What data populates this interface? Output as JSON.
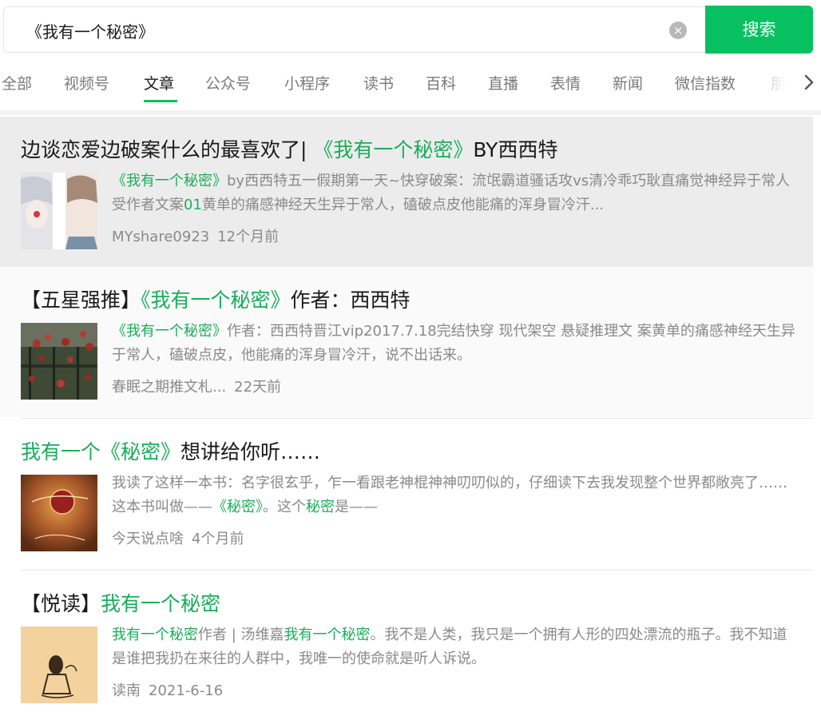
{
  "search": {
    "value": "《我有一个秘密》",
    "clear_label": "×",
    "button_label": "搜索"
  },
  "tabs": [
    "全部",
    "视频号",
    "文章",
    "公众号",
    "小程序",
    "读书",
    "百科",
    "直播",
    "表情",
    "新闻",
    "微信指数",
    "朋友"
  ],
  "active_tab": "文章",
  "results": [
    {
      "title_pre": "边谈恋爱边破案什么的最喜欢了| ",
      "title_hl": "《我有一个秘密》",
      "title_post": "BY西西特",
      "desc_hl": "《我有一个秘密》",
      "desc_rest1": "by西西特五一假期第一天~快穿破案：流氓霸道骚话攻vs清冷乖巧耿直痛觉神经异于常人受作者文案",
      "desc_hl2": "01",
      "desc_rest2": "黄单的痛感神经天生异于常人，磕破点皮他能痛的浑身冒冷汗...",
      "source": "MYshare0923",
      "time": "12个月前"
    },
    {
      "title_pre": "【五星强推】",
      "title_hl": "《我有一个秘密》",
      "title_post": "作者：西西特",
      "desc_hl": "《我有一个秘密》",
      "desc_rest1": "作者：西西特晋江vip2017.7.18完结快穿 现代架空 悬疑推理文 案黄单的痛感神经天生异于常人，磕破点皮，他能痛的浑身冒冷汗，说不出话来。",
      "source": "春眠之期推文札...",
      "time": "22天前"
    },
    {
      "title_hl": "我有一个《秘密》",
      "title_post": "想讲给你听……",
      "desc_pre": "我读了这样一本书：名字很玄乎，乍一看跟老神棍神神叨叨似的，仔细读下去我发现整个世界都敞亮了……这本书叫做——",
      "desc_hl": "《秘密》",
      "desc_mid": "。这个",
      "desc_hl2": "秘密",
      "desc_post": "是——",
      "source": "今天说点啥",
      "time": "4个月前"
    },
    {
      "title_pre": "【悦读】",
      "title_hl": "我有一个秘密",
      "desc_hl": "我有一个秘密",
      "desc_mid": "作者 | 汤维嘉",
      "desc_hl2": "我有一个秘密",
      "desc_post": "。我不是人类，我只是一个拥有人形的四处漂流的瓶子。我不知道是谁把我扔在来往的人群中，我唯一的使命就是听人诉说。",
      "source": "读南",
      "time": "2021-6-16"
    }
  ],
  "colors": {
    "accent": "#07c160",
    "highlight": "#1aad5a",
    "muted": "#8a8a8a"
  },
  "icons": [
    "clear-icon",
    "chevron-right-icon"
  ]
}
